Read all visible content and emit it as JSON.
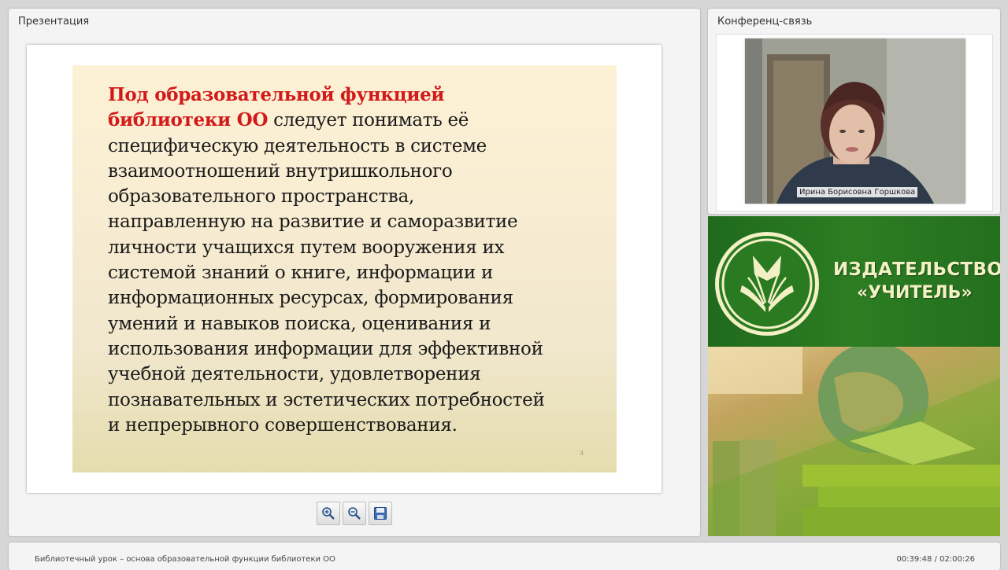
{
  "presentation": {
    "title": "Презентация",
    "slide": {
      "highlight": "Под образовательной функцией\nбиблиотеки ОО",
      "body": " следует понимать её\nспецифическую деятельность в системе\nвзаимоотношений внутришкольного\nобразовательного пространства,\nнаправленную на развитие и саморазвитие\nличности учащихся путем вооружения их\nсистемой знаний о книге, информации и\nинформационных ресурсах, формирования\nумений и навыков поиска, оценивания и\nиспользования информации для эффективной\nучебной деятельности, удовлетворения\nпознавательных и эстетических потребностей\nи непрерывного совершенствования.",
      "number": "4"
    },
    "toolbar": {
      "zoom_in_icon": "zoom-in-icon",
      "zoom_out_icon": "zoom-out-icon",
      "save_icon": "save-icon"
    }
  },
  "conference": {
    "title": "Конференц-связь",
    "participant_name": "Ирина Борисовна Горшкова"
  },
  "banner": {
    "line1": "ИЗДАТЕЛЬСТВО",
    "line2": "«УЧИТЕЛЬ»"
  },
  "footer": {
    "lesson_title": "Библиотечный урок – основа образовательной функции библиотеки ОО",
    "time": "00:39:48 / 02:00:26"
  },
  "colors": {
    "highlight": "#d21a1a",
    "banner_green": "#2c7d22",
    "brand_text": "#f3f0c6"
  }
}
